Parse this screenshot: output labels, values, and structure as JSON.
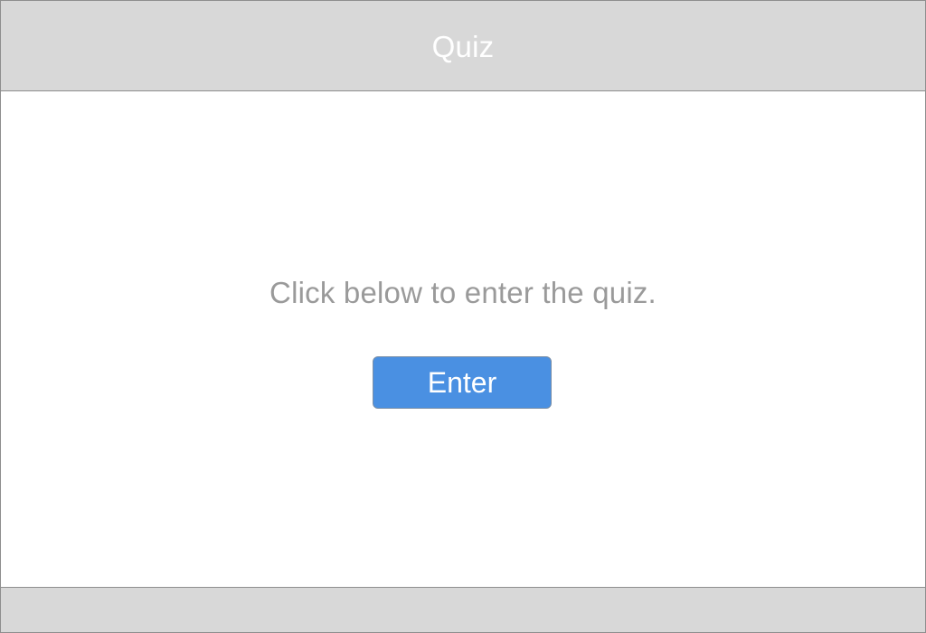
{
  "header": {
    "title": "Quiz"
  },
  "main": {
    "prompt": "Click below to enter the quiz.",
    "enter_label": "Enter"
  },
  "colors": {
    "header_background": "#d8d8d8",
    "footer_background": "#d8d8d8",
    "prompt_text": "#9a9a9a",
    "button_background": "#4a90e2",
    "button_text": "#ffffff"
  }
}
